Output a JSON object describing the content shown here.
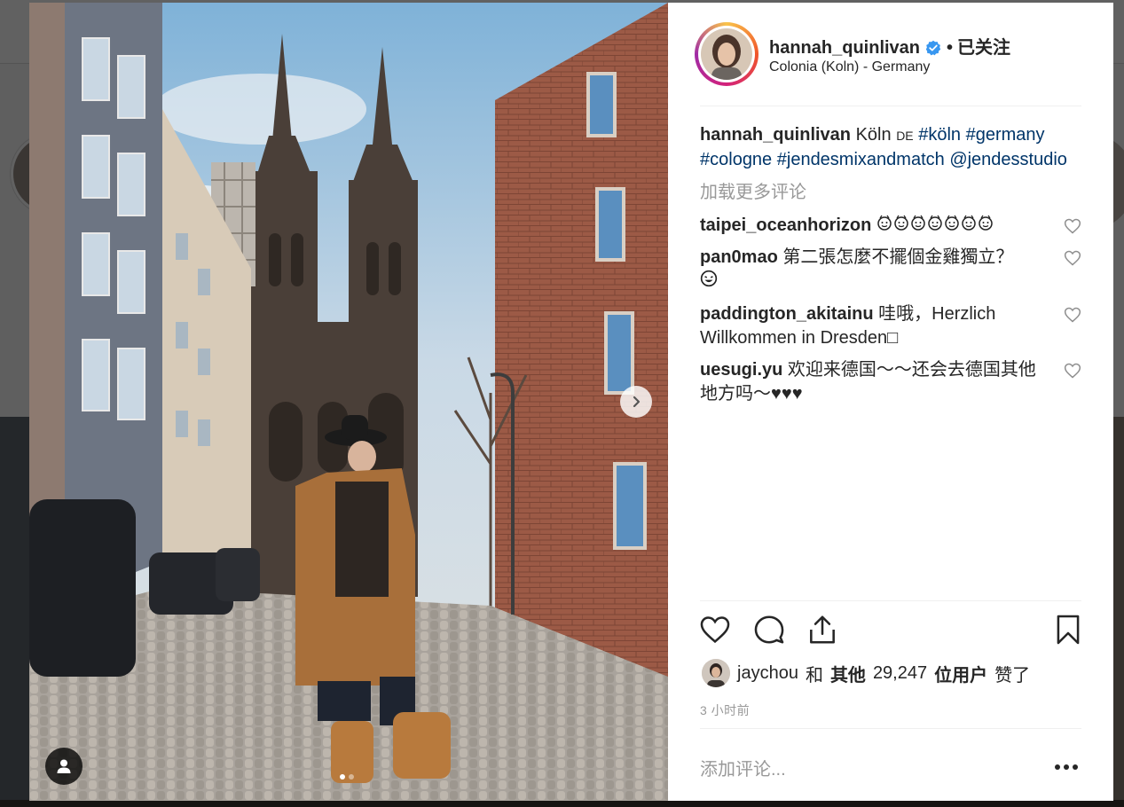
{
  "post": {
    "username": "hannah_quinlivan",
    "follow_status": "已关注",
    "separator": "•",
    "location": "Colonia (Koln) - Germany",
    "caption": {
      "username": "hannah_quinlivan",
      "text": "Köln",
      "flag": "DE",
      "hashtags": [
        "#köln",
        "#germany",
        "#cologne",
        "#jendesmixandmatch"
      ],
      "mention": "@jendesstudio"
    },
    "load_more": "加载更多评论",
    "comments": [
      {
        "username": "taipei_oceanhorizon",
        "text": "",
        "emoji_count": 7
      },
      {
        "username": "pan0mao",
        "text": "第二張怎麼不擺個金雞獨立？",
        "emoji_count": 1
      },
      {
        "username": "paddington_akitainu",
        "text": "哇哦，Herzlich Willkommen in Dresden",
        "emoji_count": 0,
        "trailing_box": "□"
      },
      {
        "username": "uesugi.yu",
        "text": "欢迎来德国～～还会去德国其他地方吗～",
        "hearts": "♥♥♥"
      }
    ],
    "likes": {
      "first_user": "jaychou",
      "and": "和",
      "others": "其他",
      "count": "29,247",
      "unit": "位用户",
      "suffix": "赞了"
    },
    "timestamp": "3 小时前",
    "add_comment_placeholder": "添加评论...",
    "carousel": {
      "slide": 1,
      "total": 2
    }
  },
  "icons": {
    "verified": "verified-badge-icon",
    "like": "heart-outline-icon",
    "comment": "speech-bubble-icon",
    "share": "share-upload-icon",
    "save": "bookmark-icon",
    "next": "chevron-right-icon",
    "user_tags": "person-icon",
    "more": "ellipsis-icon"
  },
  "colors": {
    "text": "#262626",
    "muted": "#999999",
    "hashtag": "#003569",
    "verified": "#3897f0",
    "overlay": "#000000"
  }
}
